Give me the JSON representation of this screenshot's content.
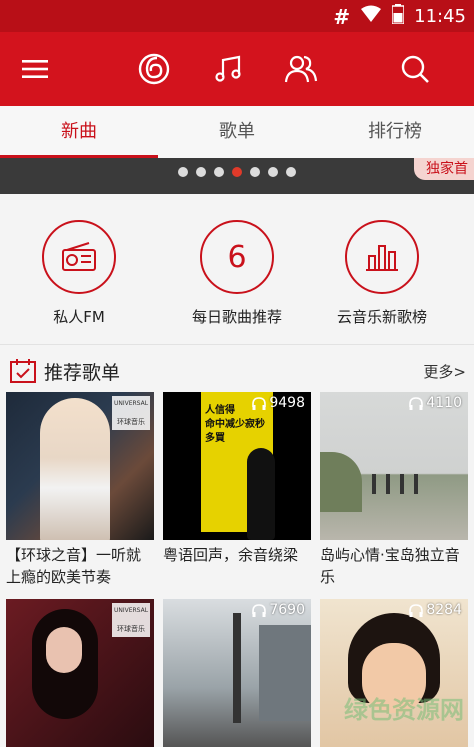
{
  "status_bar": {
    "hash_icon": "#",
    "time": "11:45"
  },
  "tabs": [
    {
      "label": "新曲",
      "active": true
    },
    {
      "label": "歌单",
      "active": false
    },
    {
      "label": "排行榜",
      "active": false
    }
  ],
  "banner": {
    "exclusive_tag": "独家首",
    "dot_count": 7,
    "active_dot": 4
  },
  "quick_links": [
    {
      "label": "私人FM",
      "icon": "radio-icon"
    },
    {
      "label": "每日歌曲推荐",
      "icon_text": "6"
    },
    {
      "label": "云音乐新歌榜",
      "icon": "bar-chart-icon"
    }
  ],
  "section": {
    "title": "推荐歌单",
    "more": "更多>"
  },
  "playlists": [
    {
      "name": "【环球之音】一听就上瘾的欧美节奏",
      "plays": "",
      "label": "环球音乐",
      "brand_mark": "UNIVERSAL"
    },
    {
      "name": "粤语回声，余音绕梁",
      "plays": "9498",
      "cover_text": "人信得\n命中减少寂秒\n多買"
    },
    {
      "name": "岛屿心情·宝岛独立音乐",
      "plays": "4110"
    },
    {
      "name": "",
      "plays": "",
      "label": "环球音乐",
      "brand_mark": "UNIVERSAL"
    },
    {
      "name": "",
      "plays": "7690"
    },
    {
      "name": "",
      "plays": "8284"
    }
  ],
  "watermark": "绿色资源网"
}
